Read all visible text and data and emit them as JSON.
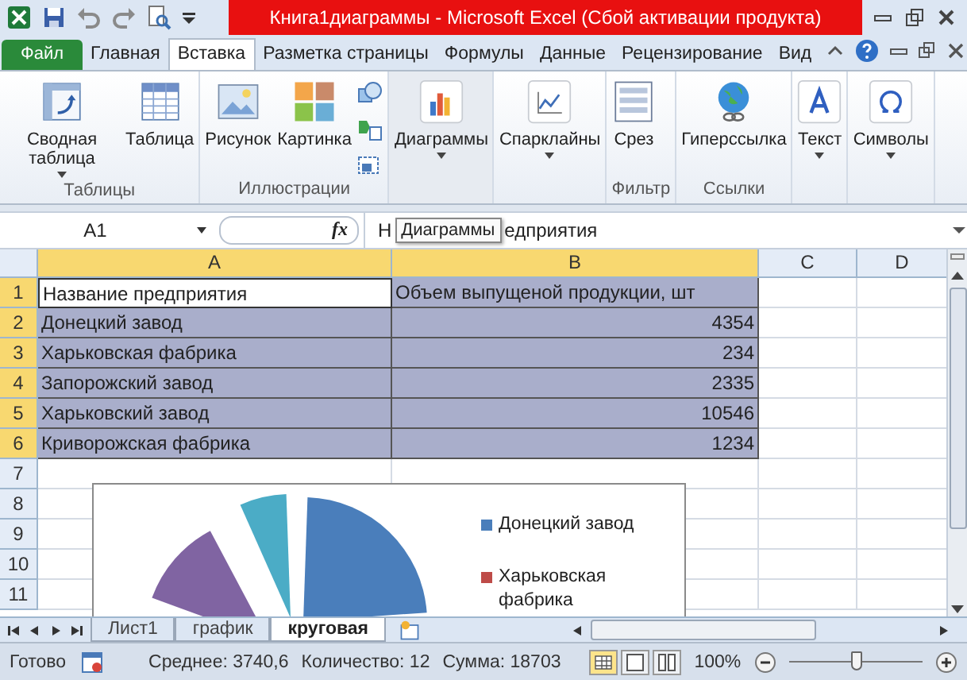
{
  "window": {
    "title": "Книга1диаграммы  -  Microsoft Excel (Сбой активации продукта)"
  },
  "tabs": [
    {
      "label": "Файл",
      "kind": "file",
      "selected": false
    },
    {
      "label": "Главная",
      "kind": "tab",
      "selected": false
    },
    {
      "label": "Вставка",
      "kind": "tab",
      "selected": true
    },
    {
      "label": "Разметка страницы",
      "kind": "tab",
      "selected": false
    },
    {
      "label": "Формулы",
      "kind": "tab",
      "selected": false
    },
    {
      "label": "Данные",
      "kind": "tab",
      "selected": false
    },
    {
      "label": "Рецензирование",
      "kind": "tab",
      "selected": false
    },
    {
      "label": "Вид",
      "kind": "tab",
      "selected": false
    }
  ],
  "ribbon_groups": [
    {
      "label": "Таблицы",
      "buttons": [
        {
          "label": "Сводная таблица",
          "dropdown": true
        },
        {
          "label": "Таблица",
          "dropdown": false
        }
      ]
    },
    {
      "label": "Иллюстрации",
      "buttons": [
        {
          "label": "Рисунок",
          "dropdown": false
        },
        {
          "label": "Картинка",
          "dropdown": false
        }
      ]
    },
    {
      "buttons": [
        {
          "label": "Диаграммы",
          "dropdown": true
        }
      ]
    },
    {
      "buttons": [
        {
          "label": "Спарклайны",
          "dropdown": true
        }
      ]
    },
    {
      "label": "Фильтр",
      "buttons": [
        {
          "label": "Срез",
          "dropdown": false
        }
      ]
    },
    {
      "label": "Ссылки",
      "buttons": [
        {
          "label": "Гиперссылка",
          "dropdown": false
        }
      ]
    },
    {
      "buttons": [
        {
          "label": "Текст",
          "dropdown": true
        }
      ]
    },
    {
      "buttons": [
        {
          "label": "Символы",
          "dropdown": true
        }
      ]
    }
  ],
  "formula_bar": {
    "name_box": "A1",
    "fx": "fx",
    "value_before": "Н",
    "tooltip": "Диаграммы",
    "value_after": "едприятия"
  },
  "columns": [
    {
      "label": "A",
      "selected": true
    },
    {
      "label": "B",
      "selected": true
    },
    {
      "label": "C",
      "selected": false
    },
    {
      "label": "D",
      "selected": false
    }
  ],
  "rows": [
    {
      "number": "1",
      "selected": true,
      "cells": [
        {
          "text": "Название предприятия",
          "active": true
        },
        {
          "text": "Объем выпущеной продукции, шт",
          "active": false
        }
      ]
    },
    {
      "number": "2",
      "selected": true,
      "cells": [
        {
          "text": "Донецкий завод",
          "active": false
        },
        {
          "text": "4354",
          "active": false
        }
      ]
    },
    {
      "number": "3",
      "selected": true,
      "cells": [
        {
          "text": "Харьковская фабрика",
          "active": false
        },
        {
          "text": "234",
          "active": false
        }
      ]
    },
    {
      "number": "4",
      "selected": true,
      "cells": [
        {
          "text": "Запорожский завод",
          "active": false
        },
        {
          "text": "2335",
          "active": false
        }
      ]
    },
    {
      "number": "5",
      "selected": true,
      "cells": [
        {
          "text": "Харьковский завод",
          "active": false
        },
        {
          "text": "10546",
          "active": false
        }
      ]
    },
    {
      "number": "6",
      "selected": true,
      "cells": [
        {
          "text": "Криворожская фабрика",
          "active": false
        },
        {
          "text": "1234",
          "active": false
        }
      ]
    },
    {
      "number": "7",
      "selected": false
    },
    {
      "number": "8",
      "selected": false
    },
    {
      "number": "9",
      "selected": false
    },
    {
      "number": "10",
      "selected": false
    },
    {
      "number": "11",
      "selected": false
    }
  ],
  "chart": {
    "legend": [
      {
        "label": "Донецкий завод",
        "color": "#4a7ebb"
      },
      {
        "label": "Харьковская фабрика",
        "color": "#be4b48"
      }
    ]
  },
  "sheet_tabs": [
    {
      "label": "Лист1",
      "selected": false
    },
    {
      "label": "график",
      "selected": false
    },
    {
      "label": "круговая",
      "selected": true
    }
  ],
  "status_bar": {
    "ready": "Готово",
    "average": "Среднее: 3740,6",
    "count": "Количество: 12",
    "sum": "Сумма: 18703",
    "views": [
      {
        "kind": "normal",
        "selected": true
      },
      {
        "kind": "page",
        "selected": false
      },
      {
        "kind": "break",
        "selected": false
      }
    ],
    "zoom": "100%",
    "zoom_level": {
      "level": 0.5
    }
  }
}
